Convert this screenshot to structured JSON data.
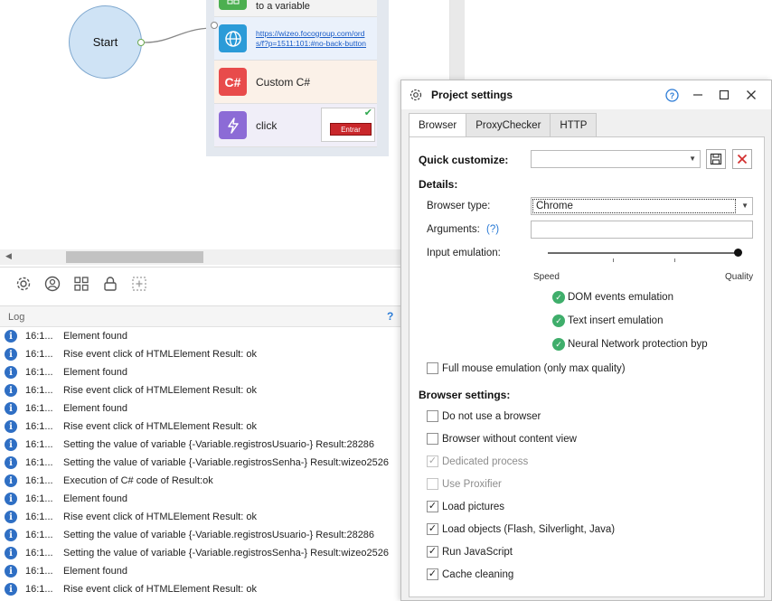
{
  "canvas": {
    "start_label": "Start",
    "blocks": {
      "top_partial": "to a variable",
      "navigate_url": "https://wizeo.focogroup.com/ords/f?p=1511:101:#no-back-button",
      "custom_cs_label": "Custom C#",
      "custom_cs_icon_text": "C#",
      "click_label": "click",
      "entrar_button": "Entrar"
    }
  },
  "log": {
    "title": "Log",
    "help": "?",
    "rows": [
      {
        "time": "16:1...",
        "msg": " Element found"
      },
      {
        "time": "16:1...",
        "msg": "Rise event click of HTMLElement  Result: ok"
      },
      {
        "time": "16:1...",
        "msg": " Element found"
      },
      {
        "time": "16:1...",
        "msg": "Rise event click of HTMLElement  Result: ok"
      },
      {
        "time": "16:1...",
        "msg": " Element found"
      },
      {
        "time": "16:1...",
        "msg": "Rise event click of HTMLElement  Result: ok"
      },
      {
        "time": "16:1...",
        "msg": "Setting the value of variable {-Variable.registrosUsuario-}  Result:28286"
      },
      {
        "time": "16:1...",
        "msg": "Setting the value of variable {-Variable.registrosSenha-}  Result:wizeo2526"
      },
      {
        "time": "16:1...",
        "msg": "Execution of C# code of  Result:ok"
      },
      {
        "time": "16:1...",
        "msg": " Element found"
      },
      {
        "time": "16:1...",
        "msg": "Rise event click of HTMLElement  Result: ok"
      },
      {
        "time": "16:1...",
        "msg": "Setting the value of variable {-Variable.registrosUsuario-}  Result:28286"
      },
      {
        "time": "16:1...",
        "msg": "Setting the value of variable {-Variable.registrosSenha-}  Result:wizeo2526"
      },
      {
        "time": "16:1...",
        "msg": " Element found"
      },
      {
        "time": "16:1...",
        "msg": "Rise event click of HTMLElement  Result: ok"
      }
    ]
  },
  "dialog": {
    "title": "Project settings",
    "help": "?",
    "tabs": [
      "Browser",
      "ProxyChecker",
      "HTTP"
    ],
    "active_tab": "Browser",
    "quick_customize_label": "Quick customize:",
    "quick_customize_value": "",
    "details_label": "Details:",
    "browser_type_label": "Browser type:",
    "browser_type_value": "Chrome",
    "arguments_label": "Arguments:",
    "arguments_help": "(?)",
    "arguments_value": "",
    "input_emulation_label": "Input emulation:",
    "input_emulation_level": 1.0,
    "slider_min_label": "Speed",
    "slider_max_label": "Quality",
    "emulation_features": [
      "DOM events emulation",
      "Text insert emulation",
      "Neural Network protection bypas"
    ],
    "full_mouse_label": "Full mouse emulation (only max quality)",
    "full_mouse_checked": false,
    "browser_settings_label": "Browser settings:",
    "browser_settings": [
      {
        "label": "Do not use a browser",
        "checked": false,
        "disabled": false
      },
      {
        "label": "Browser without content view",
        "checked": false,
        "disabled": false
      },
      {
        "label": "Dedicated process",
        "checked": true,
        "disabled": true
      },
      {
        "label": "Use Proxifier",
        "checked": false,
        "disabled": true
      },
      {
        "label": "Load pictures",
        "checked": true,
        "disabled": false
      },
      {
        "label": "Load objects (Flash, Silverlight, Java)",
        "checked": true,
        "disabled": false
      },
      {
        "label": "Run JavaScript",
        "checked": true,
        "disabled": false
      },
      {
        "label": "Cache cleaning",
        "checked": true,
        "disabled": false
      }
    ]
  },
  "colors": {
    "accent": "#2b7bd6",
    "start_node": "#cfe3f5",
    "csharp_icon": "#e84b4b",
    "click_icon": "#8c6bd6",
    "navigate_icon": "#2b9bd8",
    "variable_icon": "#4caf50",
    "green_check": "#3fae6b",
    "delete_red": "#d32f2f"
  }
}
